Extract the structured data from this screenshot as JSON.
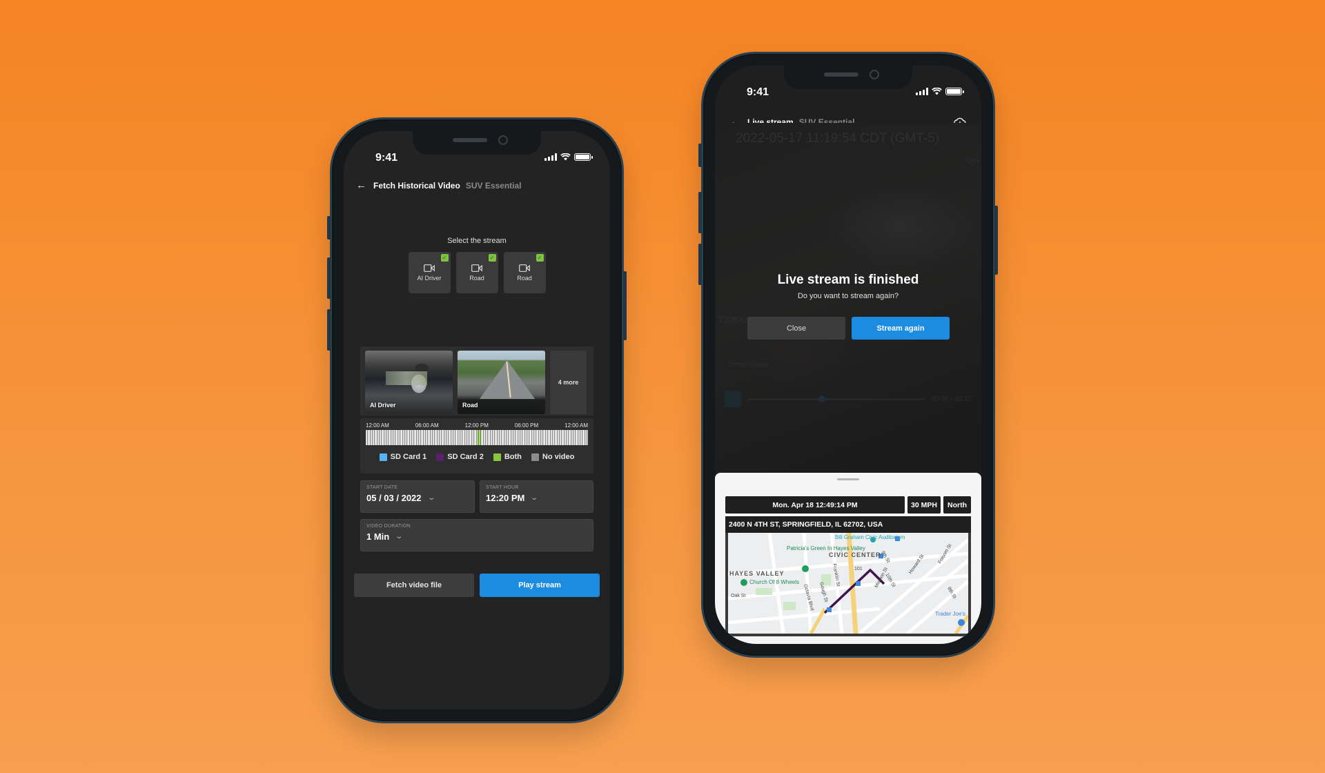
{
  "colors": {
    "background_top": "#f58423",
    "background_bottom": "#f79f4f",
    "primary_button": "#1c8ce3",
    "check_green": "#7dc242",
    "legend_sd_card_1": "#56b4f2",
    "legend_sd_card_2": "#5a1f6e",
    "legend_both": "#8ac43f",
    "legend_no_video": "#8c8c8c",
    "route_line": "#3d1450"
  },
  "left_phone": {
    "status_time": "9:41",
    "nav": {
      "back_icon": "arrow-left-icon",
      "title": "Fetch Historical Video",
      "subtitle": "SUV Essential"
    },
    "stream_select": {
      "label": "Select the stream",
      "streams": [
        {
          "label": "AI Driver",
          "icon": "video-camera-icon",
          "checked": true
        },
        {
          "label": "Road",
          "icon": "video-camera-icon",
          "checked": true
        },
        {
          "label": "Road",
          "icon": "video-camera-icon",
          "checked": true
        }
      ]
    },
    "previews": {
      "items": [
        {
          "label": "AI Driver"
        },
        {
          "label": "Road"
        }
      ],
      "more_label": "4 more"
    },
    "timeline": {
      "tick_labels": [
        "12:00 AM",
        "06:00 AM",
        "12:00 PM",
        "06:00 PM",
        "12:00 AM"
      ],
      "both_range_fraction": [
        0.49,
        0.52
      ],
      "legend": [
        {
          "label": "SD Card 1",
          "color": "#56b4f2"
        },
        {
          "label": "SD Card 2",
          "color": "#5a1f6e"
        },
        {
          "label": "Both",
          "color": "#8ac43f"
        },
        {
          "label": "No video",
          "color": "#8c8c8c"
        }
      ]
    },
    "form": {
      "start_date": {
        "label": "START DATE",
        "value": "05 / 03 / 2022"
      },
      "start_hour": {
        "label": "START HOUR",
        "value": "12:20 PM"
      },
      "video_duration": {
        "label": "VIDEO DURATION",
        "value": "1 Min"
      }
    },
    "buttons": {
      "fetch": "Fetch video file",
      "play": "Play stream"
    }
  },
  "right_phone": {
    "status_time": "9:41",
    "nav": {
      "back_icon": "arrow-left-icon",
      "title": "Live stream",
      "subtitle": "SUV Essential",
      "action_icon": "cloud-download-icon"
    },
    "video": {
      "timestamp": "2022-05-17 11:19:54 CDT (GMT-5)",
      "corner_text": "0In",
      "stream_id": "T2080UI",
      "stream_name": "Stream name",
      "time_readout": "00:00 / 00:10"
    },
    "dialog": {
      "title": "Live stream is finished",
      "message": "Do you want to stream again?",
      "close_label": "Close",
      "stream_again_label": "Stream again"
    },
    "info_sheet": {
      "datetime": "Mon. Apr 18 12:49:14 PM",
      "speed": "30 MPH",
      "heading": "North",
      "address": "2400 N 4TH ST, SPRINGFIELD, IL 62702, USA",
      "map_labels": {
        "hayes_valley": "HAYES VALLEY",
        "civic_center": "CIVIC CENTER",
        "patricias_green": "Patricia's Green In Hayes Valley",
        "bill_graham": "Bill Graham Civic Auditorium",
        "church": "Church Of 8 Wheels",
        "trader_joes": "Trader Joe's",
        "oak_st": "Oak St",
        "octavia": "Octavia Blvd",
        "gough": "Gough St",
        "franklin": "Franklin St",
        "mission": "Mission St",
        "howard": "Howard St",
        "folsom": "Folsom St",
        "tenth": "10th St",
        "ninth": "9th St",
        "eighth": "8th St",
        "hwy": "101"
      }
    }
  }
}
